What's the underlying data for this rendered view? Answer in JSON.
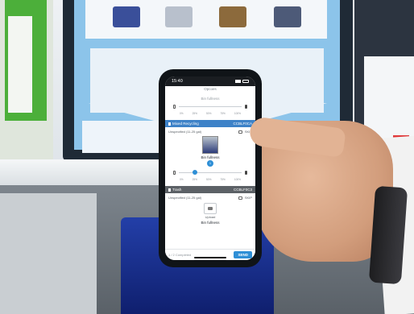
{
  "phone": {
    "time": "15:40",
    "nav_title": "Opcoes",
    "top_bin_label": "Bin fullness",
    "top_ticks": [
      "0%",
      "25%",
      "50%",
      "75%",
      "100%"
    ],
    "sections": [
      {
        "name": "Mixed Recycling",
        "code": "CCBLF0CA",
        "status": "Unspecified (11-25 gal)",
        "skip": "SKIP",
        "bin_label": "Bin fullness",
        "badge": "1",
        "ticks": [
          "0%",
          "25%",
          "50%",
          "75%",
          "100%"
        ],
        "fill_fraction": 0.25
      },
      {
        "name": "Trash",
        "code": "CCBLF0C3",
        "status": "Unspecified (11-25 gal)",
        "skip": "SKIP",
        "upload_label": "Upload",
        "bin_label": "Bin fullness"
      }
    ],
    "footer_text": "1 / 2 Completed",
    "send_label": "SEND",
    "accent_color": "#2f8fd6"
  }
}
